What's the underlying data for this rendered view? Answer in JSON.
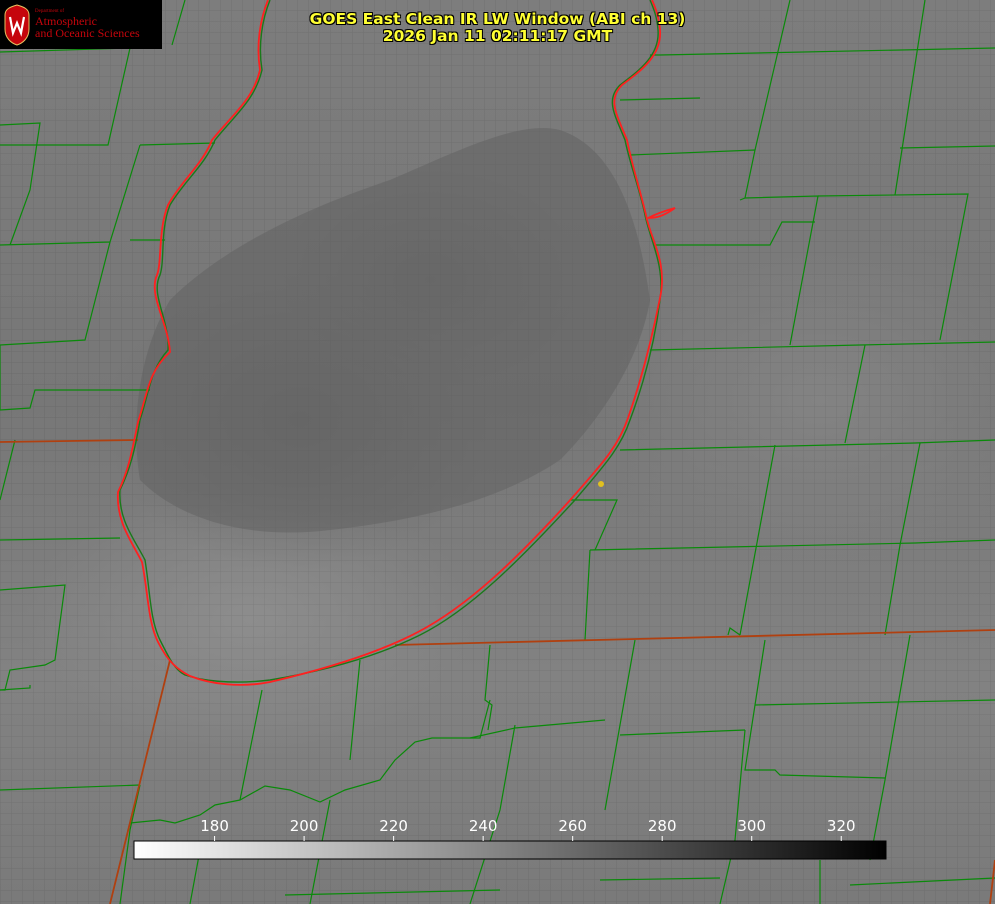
{
  "header": {
    "title_line1": "GOES East Clean IR LW Window (ABI ch 13)",
    "title_line2": "2026 Jan 11 02:11:17 GMT"
  },
  "logo": {
    "dept_text": "Department of",
    "line1": "Atmospheric",
    "line2": "and Oceanic Sciences",
    "emblem_icon": "uw-crest-icon",
    "brand_color": "#c5050c"
  },
  "colorbar": {
    "ticks": [
      "180",
      "200",
      "220",
      "240",
      "260",
      "280",
      "300",
      "320"
    ],
    "tick_values": [
      180,
      200,
      220,
      240,
      260,
      280,
      300,
      320
    ],
    "range": [
      162,
      330
    ],
    "color_low": "#ffffff",
    "color_high": "#000000"
  },
  "map": {
    "lake_outline_color": "#ff2020",
    "boundary_color": "#0a8a0a",
    "state_line_color": "#b04010",
    "station_marker_color": "#e0c020"
  }
}
